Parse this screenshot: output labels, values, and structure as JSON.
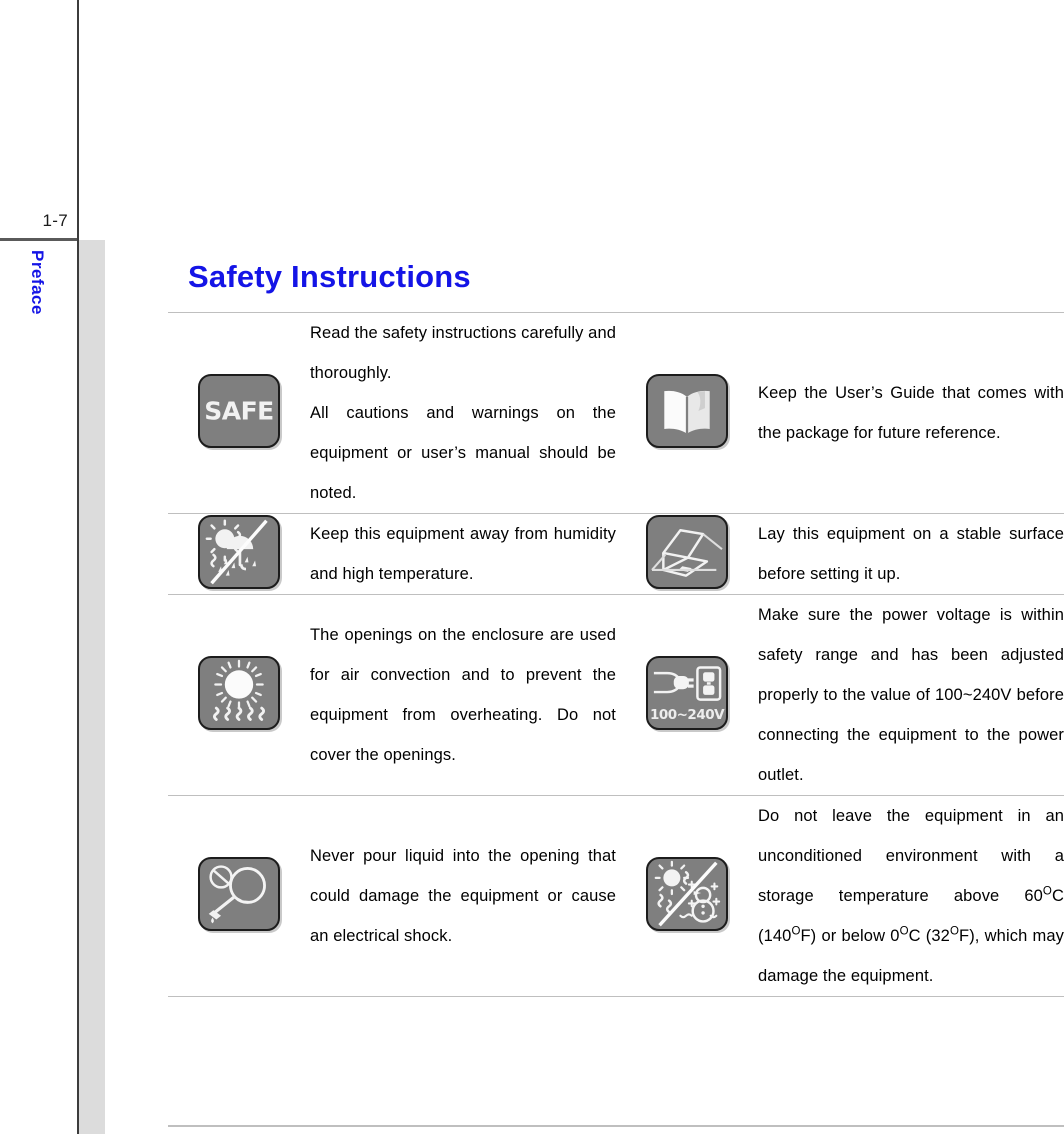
{
  "page": {
    "folio": "1-7",
    "section_tab": "Preface",
    "title": "Safety Instructions",
    "accent_color": "#1414e6",
    "icon_fill": "#7f7f7f",
    "rule_color": "#bfbfbf"
  },
  "rows": [
    {
      "left": {
        "icon_name": "safe-badge-icon",
        "icon_label": "SAFE",
        "paragraphs": [
          "Read the safety instructions carefully and thoroughly.",
          "All cautions and warnings on the equipment or user’s manual should be noted."
        ]
      },
      "right": {
        "icon_name": "open-book-icon",
        "paragraphs": [
          "Keep the User’s Guide that comes with the package for future reference."
        ]
      }
    },
    {
      "left": {
        "icon_name": "no-humidity-heat-icon",
        "paragraphs": [
          "Keep this equipment away from humidity and high temperature."
        ]
      },
      "right": {
        "icon_name": "laptop-on-stable-surface-icon",
        "paragraphs": [
          "Lay this equipment on a stable surface before setting it up."
        ]
      }
    },
    {
      "left": {
        "icon_name": "heat-radiation-vent-icon",
        "paragraphs": [
          "The openings on the enclosure are used for air convection and to prevent the equipment from overheating.  Do not cover the openings."
        ]
      },
      "right": {
        "icon_name": "power-plug-voltage-icon",
        "icon_label": "100~240V",
        "paragraphs": [
          "Make sure the power voltage is within safety range and has been adjusted properly to the value of 100~240V before connecting the equipment to the power outlet."
        ]
      }
    },
    {
      "left": {
        "icon_name": "no-liquid-icon",
        "paragraphs": [
          "Never pour liquid into the opening that could damage the equipment or cause an electrical shock."
        ]
      },
      "right": {
        "icon_name": "temperature-extremes-icon",
        "paragraphs_rich": [
          "Do not leave the equipment in an unconditioned environment with a storage temperature above 60<sup>O</sup>C (140<sup>O</sup>F) or below 0<sup>O</sup>C (32<sup>O</sup>F), which may damage the equipment."
        ],
        "paragraphs": [
          "Do not leave the equipment in an unconditioned environment with a storage temperature above 60OC (140OF) or below 0OC (32OF), which may damage the equipment."
        ]
      }
    }
  ]
}
